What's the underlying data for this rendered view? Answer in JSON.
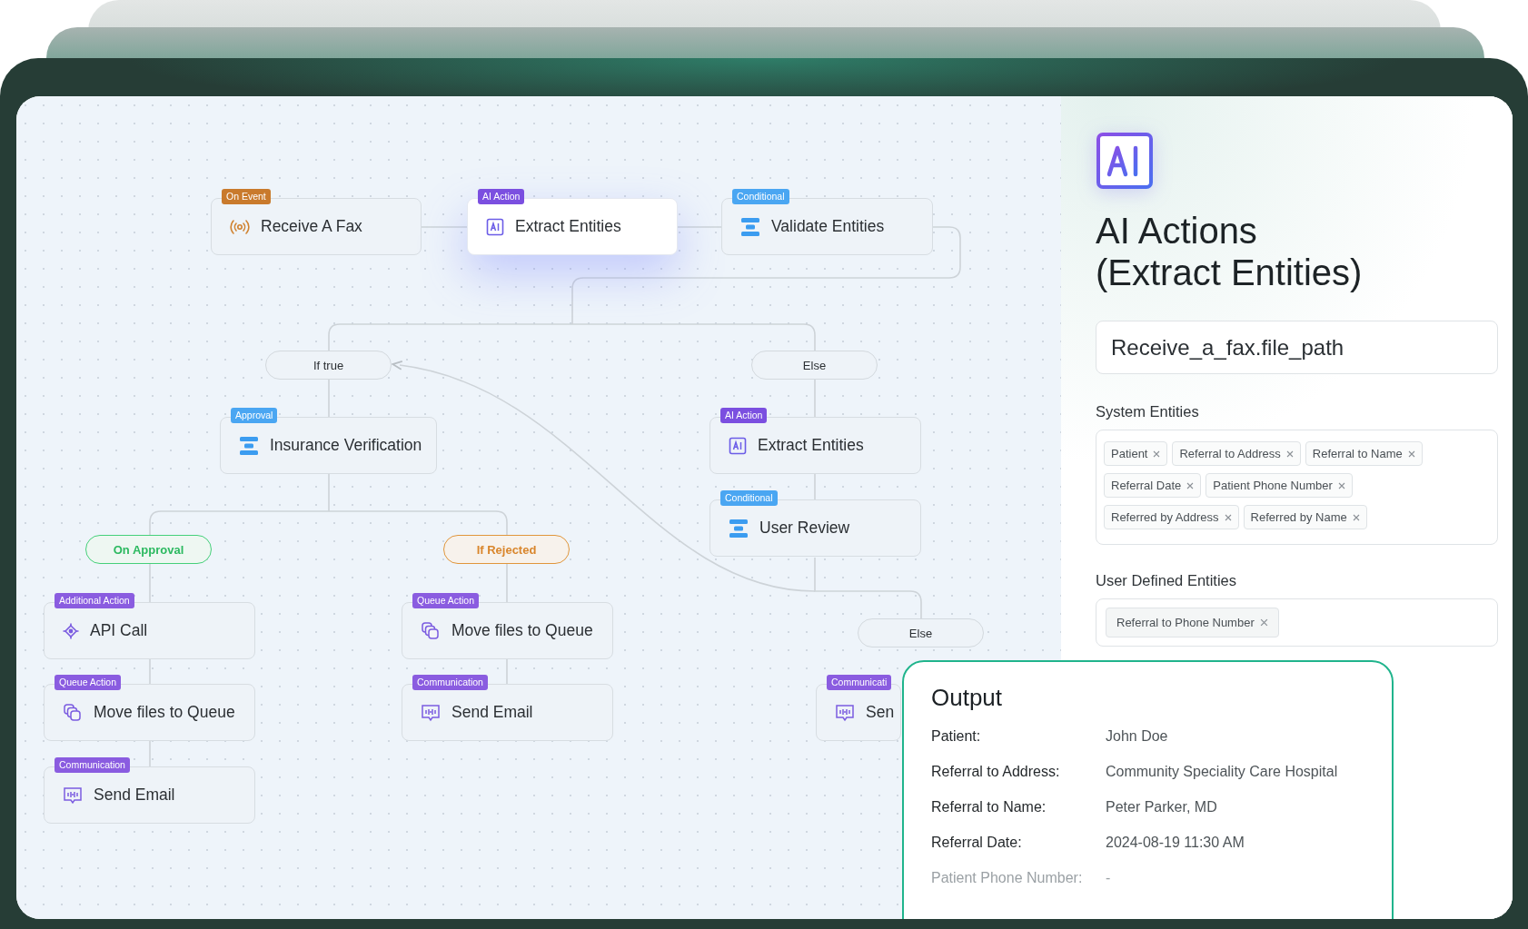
{
  "flow": {
    "nodes": [
      {
        "tag": "On Event",
        "color": "#c97a2c",
        "label": "Receive A Fax",
        "kind": "signal",
        "selected": false
      },
      {
        "tag": "AI Action",
        "color": "#7b4fe0",
        "label": "Extract Entities",
        "kind": "ai",
        "selected": true
      },
      {
        "tag": "Conditional",
        "color": "#4aa6f2",
        "label": "Validate Entities",
        "kind": "condition",
        "selected": false
      },
      {
        "tag": "Approval",
        "color": "#4aa6f2",
        "label": "Insurance Verification",
        "kind": "condition",
        "selected": false
      },
      {
        "tag": "AI Action",
        "color": "#7b4fe0",
        "label": "Extract Entities",
        "kind": "ai",
        "selected": false
      },
      {
        "tag": "Conditional",
        "color": "#4aa6f2",
        "label": "User Review",
        "kind": "condition",
        "selected": false
      },
      {
        "tag": "Additional Action",
        "color": "#8a5ce0",
        "label": "API Call",
        "kind": "api",
        "selected": false
      },
      {
        "tag": "Queue Action",
        "color": "#8a5ce0",
        "label": "Move files to Queue",
        "kind": "queue",
        "selected": false
      },
      {
        "tag": "Communication",
        "color": "#8a5ce0",
        "label": "Send Email",
        "kind": "email",
        "selected": false
      },
      {
        "tag": "Queue Action",
        "color": "#8a5ce0",
        "label": "Move files to Queue",
        "kind": "queue",
        "selected": false
      },
      {
        "tag": "Communication",
        "color": "#8a5ce0",
        "label": "Send Email",
        "kind": "email",
        "selected": false
      },
      {
        "tag": "Communicati",
        "color": "#8a5ce0",
        "label": "Sen",
        "kind": "email",
        "selected": false
      }
    ],
    "branches": [
      {
        "label": "If true",
        "kind": "plain"
      },
      {
        "label": "Else",
        "kind": "plain"
      },
      {
        "label": "On Approval",
        "kind": "approve"
      },
      {
        "label": "If Rejected",
        "kind": "reject"
      },
      {
        "label": "Else",
        "kind": "plain"
      }
    ]
  },
  "panel": {
    "title_line_1": "AI Actions",
    "title_line_2": "(Extract Entities)",
    "input": "Receive_a_fax.file_path",
    "system_entities": {
      "label": "System Entities",
      "chips": [
        "Patient",
        "Referral to Address",
        "Referral to Name",
        "Referral Date",
        "Patient Phone Number",
        "Referred by Address",
        "Referred by Name"
      ]
    },
    "user_entities": {
      "label": "User Defined Entities",
      "chips": [
        "Referral to Phone Number"
      ]
    }
  },
  "output": {
    "title": "Output",
    "rows": [
      {
        "label": "Patient:",
        "value": "John Doe",
        "dimmed": false
      },
      {
        "label": "Referral to Address:",
        "value": "Community Speciality Care Hospital",
        "dimmed": false
      },
      {
        "label": "Referral to Name:",
        "value": "Peter Parker, MD",
        "dimmed": false
      },
      {
        "label": "Referral Date:",
        "value": "2024-08-19 11:30 AM",
        "dimmed": false
      },
      {
        "label": "Patient Phone Number:",
        "value": "-",
        "dimmed": true
      }
    ]
  }
}
